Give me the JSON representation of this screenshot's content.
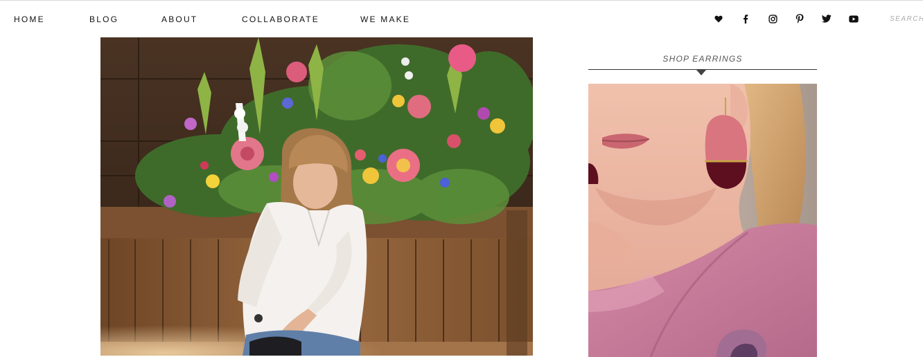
{
  "nav": {
    "items": [
      {
        "label": "HOME"
      },
      {
        "label": "BLOG"
      },
      {
        "label": "ABOUT"
      },
      {
        "label": "COLLABORATE"
      },
      {
        "label": "WE MAKE"
      }
    ]
  },
  "social": {
    "icons": [
      "heart-icon",
      "facebook-icon",
      "instagram-icon",
      "pinterest-icon",
      "twitter-icon",
      "youtube-icon"
    ]
  },
  "search": {
    "placeholder": "SEARCH"
  },
  "sidebar": {
    "widget_title": "SHOP EARRINGS"
  },
  "colors": {
    "text": "#111111",
    "rule": "#333333",
    "wood": "#8a5a33",
    "earring_pink": "#d97582",
    "earring_dark": "#6a1422",
    "sweater": "#c97b9a"
  }
}
